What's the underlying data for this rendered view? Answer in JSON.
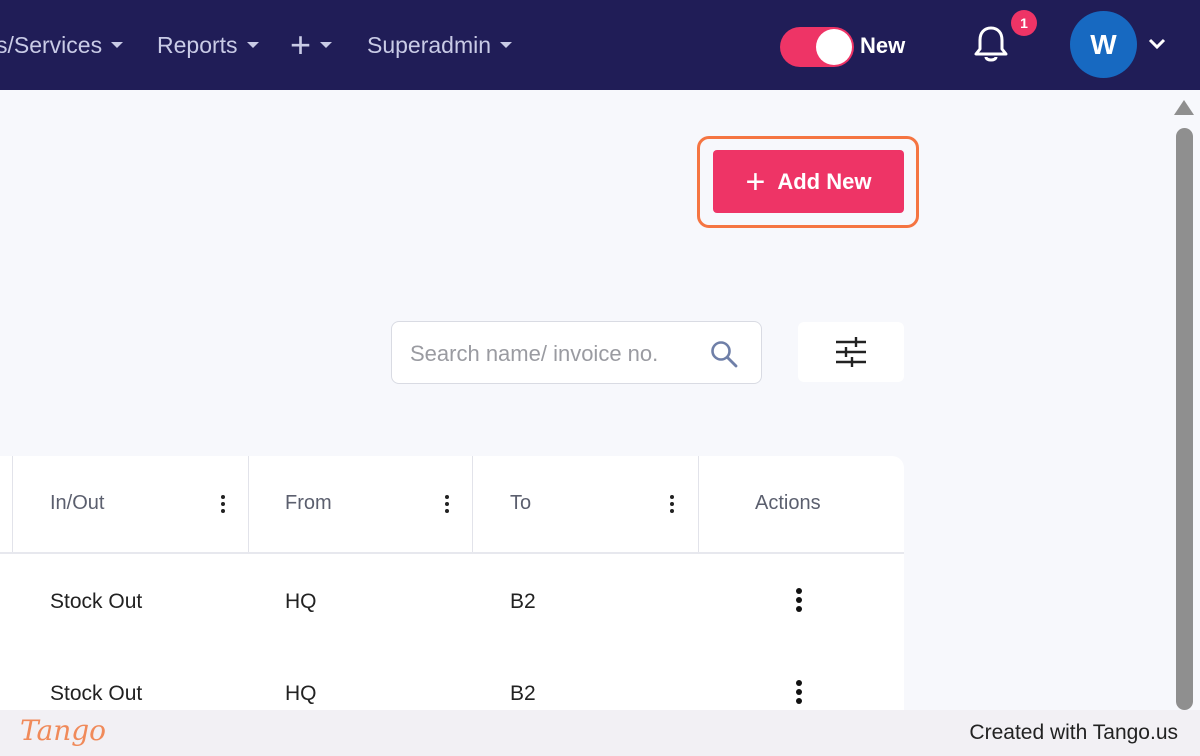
{
  "nav": {
    "items": [
      {
        "label": "s/Services"
      },
      {
        "label": "Reports"
      },
      {
        "label": "+"
      },
      {
        "label": "Superadmin"
      }
    ],
    "toggle_label": "New",
    "notification_count": "1",
    "avatar_initial": "W"
  },
  "toolbar": {
    "add_new_label": "Add New"
  },
  "search": {
    "placeholder": "Search name/ invoice no."
  },
  "table": {
    "columns": [
      "In/Out",
      "From",
      "To",
      "Actions"
    ],
    "rows": [
      {
        "in_out": "Stock Out",
        "from": "HQ",
        "to": "B2"
      },
      {
        "in_out": "Stock Out",
        "from": "HQ",
        "to": "B2"
      }
    ]
  },
  "footer": {
    "logo": "Tango",
    "created_with": "Created with Tango.us"
  },
  "colors": {
    "navbar": "#201d57",
    "accent": "#ee3466",
    "highlight": "#f57542",
    "avatar": "#1769c1"
  }
}
